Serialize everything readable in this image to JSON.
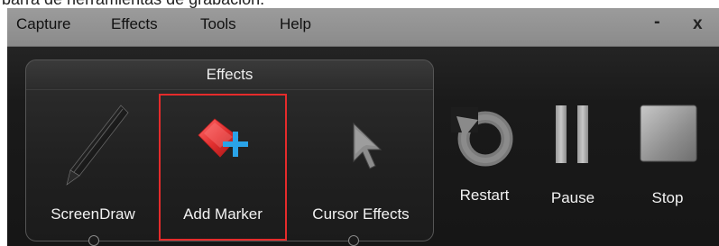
{
  "caption": "barra de herramientas de grabación.",
  "menu": {
    "items": [
      "Capture",
      "Effects",
      "Tools",
      "Help"
    ],
    "minimize_label": "-",
    "close_label": "x"
  },
  "effects": {
    "title": "Effects",
    "tools": [
      {
        "label": "ScreenDraw",
        "icon": "pen-icon"
      },
      {
        "label": "Add Marker",
        "icon": "add-marker-icon",
        "highlighted": true
      },
      {
        "label": "Cursor Effects",
        "icon": "cursor-arrow-icon"
      }
    ]
  },
  "controls": {
    "restart": "Restart",
    "pause": "Pause",
    "stop": "Stop"
  },
  "colors": {
    "highlight": "#e52b2b",
    "marker_red": "#e23030",
    "plus_blue": "#2aa3e8"
  }
}
